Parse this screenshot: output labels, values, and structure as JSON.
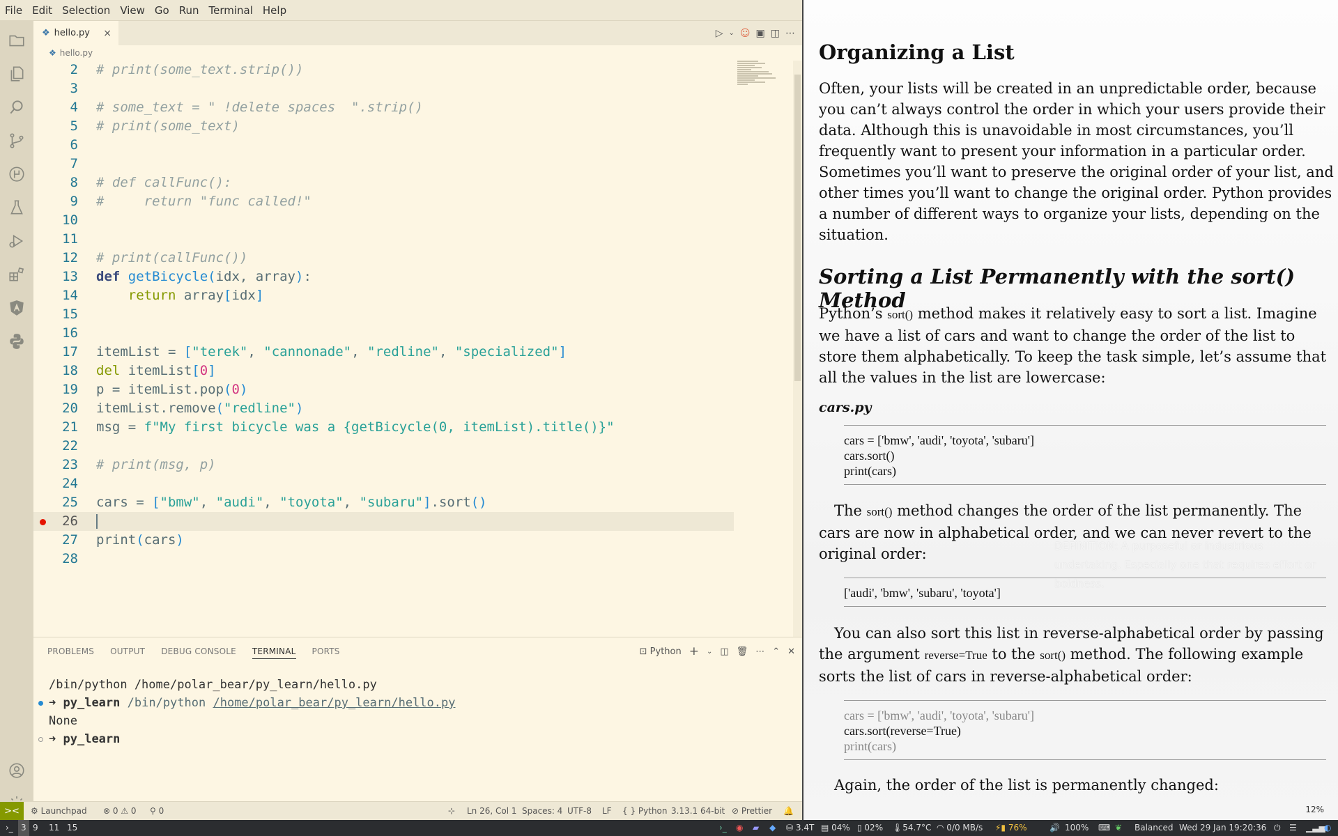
{
  "menubar": {
    "items": [
      "File",
      "Edit",
      "Selection",
      "View",
      "Go",
      "Run",
      "Terminal",
      "Help"
    ]
  },
  "tab": {
    "filename": "hello.py",
    "close": "×"
  },
  "breadcrumb": {
    "file": "hello.py"
  },
  "editor": {
    "lines": [
      {
        "n": "2",
        "code": [
          [
            "tok-comment",
            "# print(some_text.strip())"
          ]
        ]
      },
      {
        "n": "3",
        "code": []
      },
      {
        "n": "4",
        "code": [
          [
            "tok-comment",
            "# some_text = \" !delete spaces  \".strip()"
          ]
        ]
      },
      {
        "n": "5",
        "code": [
          [
            "tok-comment",
            "# print(some_text)"
          ]
        ]
      },
      {
        "n": "6",
        "code": []
      },
      {
        "n": "7",
        "code": []
      },
      {
        "n": "8",
        "code": [
          [
            "tok-comment",
            "# def callFunc():"
          ]
        ]
      },
      {
        "n": "9",
        "code": [
          [
            "tok-comment",
            "#     return \"func called!\""
          ]
        ]
      },
      {
        "n": "10",
        "code": []
      },
      {
        "n": "11",
        "code": []
      },
      {
        "n": "12",
        "code": [
          [
            "tok-comment",
            "# print(callFunc())"
          ]
        ]
      },
      {
        "n": "13",
        "code": [
          [
            "tok-kw",
            "def "
          ],
          [
            "tok-fn",
            "getBicycle"
          ],
          [
            "tok-br",
            "("
          ],
          [
            "tok-var",
            "idx, array"
          ],
          [
            "tok-br",
            ")"
          ],
          [
            "tok-var",
            ":"
          ]
        ]
      },
      {
        "n": "14",
        "code": [
          [
            "tok-var",
            "    "
          ],
          [
            "tok-ret",
            "return "
          ],
          [
            "tok-var",
            "array"
          ],
          [
            "tok-br",
            "["
          ],
          [
            "tok-var",
            "idx"
          ],
          [
            "tok-br",
            "]"
          ]
        ]
      },
      {
        "n": "15",
        "code": []
      },
      {
        "n": "16",
        "code": []
      },
      {
        "n": "17",
        "code": [
          [
            "tok-var",
            "itemList = "
          ],
          [
            "tok-br",
            "["
          ],
          [
            "tok-str",
            "\"terek\""
          ],
          [
            "tok-var",
            ", "
          ],
          [
            "tok-str",
            "\"cannonade\""
          ],
          [
            "tok-var",
            ", "
          ],
          [
            "tok-str",
            "\"redline\""
          ],
          [
            "tok-var",
            ", "
          ],
          [
            "tok-str",
            "\"specialized\""
          ],
          [
            "tok-br",
            "]"
          ]
        ]
      },
      {
        "n": "18",
        "code": [
          [
            "tok-ret",
            "del "
          ],
          [
            "tok-var",
            "itemList"
          ],
          [
            "tok-br",
            "["
          ],
          [
            "tok-num",
            "0"
          ],
          [
            "tok-br",
            "]"
          ]
        ]
      },
      {
        "n": "19",
        "code": [
          [
            "tok-var",
            "p = itemList.pop"
          ],
          [
            "tok-br",
            "("
          ],
          [
            "tok-num",
            "0"
          ],
          [
            "tok-br",
            ")"
          ]
        ]
      },
      {
        "n": "20",
        "code": [
          [
            "tok-var",
            "itemList.remove"
          ],
          [
            "tok-br",
            "("
          ],
          [
            "tok-str",
            "\"redline\""
          ],
          [
            "tok-br",
            ")"
          ]
        ]
      },
      {
        "n": "21",
        "code": [
          [
            "tok-var",
            "msg = "
          ],
          [
            "tok-str",
            "f\"My first bicycle was a {getBicycle(0, itemList).title()}\""
          ]
        ]
      },
      {
        "n": "22",
        "code": []
      },
      {
        "n": "23",
        "code": [
          [
            "tok-comment",
            "# print(msg, p)"
          ]
        ]
      },
      {
        "n": "24",
        "code": []
      },
      {
        "n": "25",
        "code": [
          [
            "tok-var",
            "cars = "
          ],
          [
            "tok-br",
            "["
          ],
          [
            "tok-str",
            "\"bmw\""
          ],
          [
            "tok-var",
            ", "
          ],
          [
            "tok-str",
            "\"audi\""
          ],
          [
            "tok-var",
            ", "
          ],
          [
            "tok-str",
            "\"toyota\""
          ],
          [
            "tok-var",
            ", "
          ],
          [
            "tok-str",
            "\"subaru\""
          ],
          [
            "tok-br",
            "]"
          ],
          [
            "tok-var",
            ".sort"
          ],
          [
            "tok-br",
            "()"
          ]
        ]
      },
      {
        "n": "26",
        "code": [],
        "current": true,
        "breakpoint": true
      },
      {
        "n": "27",
        "code": [
          [
            "tok-var",
            "print"
          ],
          [
            "tok-br",
            "("
          ],
          [
            "tok-var",
            "cars"
          ],
          [
            "tok-br",
            ")"
          ]
        ]
      },
      {
        "n": "28",
        "code": []
      }
    ]
  },
  "panel": {
    "tabs": [
      "PROBLEMS",
      "OUTPUT",
      "DEBUG CONSOLE",
      "TERMINAL",
      "PORTS"
    ],
    "active_tab": "TERMINAL",
    "terminal_profile": "Python",
    "terminal": {
      "line1": "/bin/python /home/polar_bear/py_learn/hello.py",
      "prompt": "➜",
      "dir": "py_learn",
      "cmd_bin": "/bin/python",
      "cmd_path": "/home/polar_bear/py_learn/hello.py",
      "output": "None"
    }
  },
  "statusbar": {
    "remote": "><",
    "launchpad": "Launchpad",
    "problems": "⊗ 0 ⚠ 0",
    "ports": "⚲ 0",
    "position": "Ln 26, Col 1",
    "spaces": "Spaces: 4",
    "encoding": "UTF-8",
    "eol": "LF",
    "language": "{ } Python",
    "interpreter": "3.13.1 64-bit",
    "formatter": "Prettier"
  },
  "reader": {
    "heading": "Organizing a List",
    "intro": "Often, your lists will be created in an unpredictable order, because you can’t always control the order in which your users provide their data. Although this is unavoidable in most circumstances, you’ll frequently want to present your information in a particular order. Sometimes you’ll want to preserve the original order of your list, and other times you’ll want to change the original order. Python provides a number of different ways to organize your lists, depending on the situation.",
    "subheading": "Sorting a List Permanently with the sort() Method",
    "para2_a": "Python’s ",
    "para2_code": "sort()",
    "para2_b": " method makes it relatively easy to sort a list. Imagine we have a list of cars and want to change the order of the list to store them alphabetically. To keep the task simple, let’s assume that all the values in the list are lowercase:",
    "file_label": "cars.py",
    "code1": [
      "cars = ['bmw', 'audi', 'toyota', 'subaru']",
      "cars.sort()",
      "print(cars)"
    ],
    "para3_a": "The ",
    "para3_code": "sort()",
    "para3_b": " method changes the order of the list permanently. The cars are now in alphabetical order, and we can never revert to the original order:",
    "code2": [
      "['audi', 'bmw', 'subaru', 'toyota']"
    ],
    "para4_a": "You can also sort this list in reverse-alphabetical order by passing the argument ",
    "para4_code1": "reverse=True",
    "para4_b": " to the ",
    "para4_code2": "sort()",
    "para4_c": " method. The following example sorts the list of cars in reverse-alphabetical order:",
    "code3": [
      "cars = ['bmw', 'audi', 'toyota', 'subaru']",
      "cars.sort(reverse=True)",
      "print(cars)"
    ],
    "para5": "Again, the order of the list is permanently changed:",
    "watermark": "DEFINITION: A purposeful or industrious undertaking. Especially one that requires effort or boldness.",
    "zoom": "12%"
  },
  "taskbar": {
    "workspaces": [
      "3",
      "9",
      "11",
      "15"
    ],
    "disk": "3.4T",
    "cpu": "04%",
    "mem": "02%",
    "temp": "54.7°C",
    "net": "0/0 MB/s",
    "battery": "76%",
    "volume": "100%",
    "power_mode": "Balanced",
    "datetime": "Wed 29 Jan 19:20:36"
  }
}
